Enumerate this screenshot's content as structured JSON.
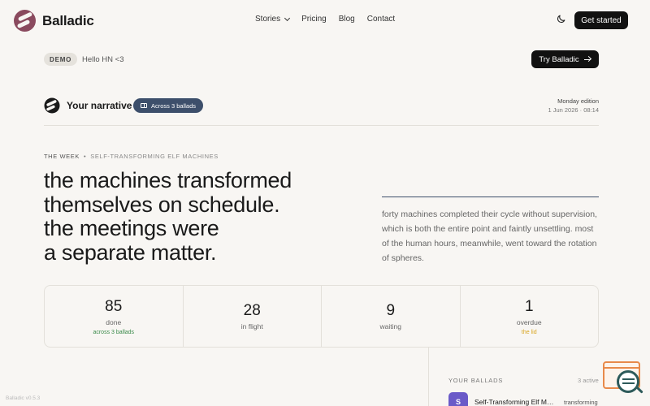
{
  "nav": {
    "brand": "Balladic",
    "links": [
      {
        "label": "Stories",
        "has_dropdown": true
      },
      {
        "label": "Pricing"
      },
      {
        "label": "Blog"
      },
      {
        "label": "Contact"
      }
    ],
    "theme_icon": "moon-icon",
    "cta": "Get started"
  },
  "demo": {
    "badge": "DEMO",
    "greeting": "Hello HN <3",
    "try_button": "Try Balladic"
  },
  "narrative": {
    "title": "Your narrative",
    "pill": "Across 3 ballads",
    "edition": "Monday edition",
    "timestamp": "1 Jun 2026 · 08:14"
  },
  "week": {
    "label": "THE WEEK",
    "subtitle": "SELF-TRANSFORMING ELF MACHINES",
    "headline_lines": [
      "the machines transformed",
      "themselves on schedule.",
      "the meetings were",
      "a separate matter."
    ],
    "summary": "forty machines completed their cycle without supervision, which is both the entire point and faintly unsettling. most of the human hours, meanwhile, went toward the rotation of spheres."
  },
  "stats": [
    {
      "value": "85",
      "label": "done",
      "note": "across 3 ballads",
      "note_color": "#3a8a4a"
    },
    {
      "value": "28",
      "label": "in flight",
      "note": "",
      "note_color": ""
    },
    {
      "value": "9",
      "label": "waiting",
      "note": "",
      "note_color": ""
    },
    {
      "value": "1",
      "label": "overdue",
      "note": "the lid",
      "note_color": "#d9a520"
    }
  ],
  "ballads": {
    "label": "YOUR BALLADS",
    "count": "3 active",
    "items": [
      {
        "avatar": "S",
        "name": "Self-Transforming Elf Machines",
        "status": "transforming",
        "color": "#6a5ac8"
      }
    ]
  },
  "footer": {
    "version": "Balladic v0.5.3"
  },
  "colors": {
    "accent": "#3d4f6b",
    "brand": "#8a4a5e",
    "background": "#f8f6f3"
  }
}
